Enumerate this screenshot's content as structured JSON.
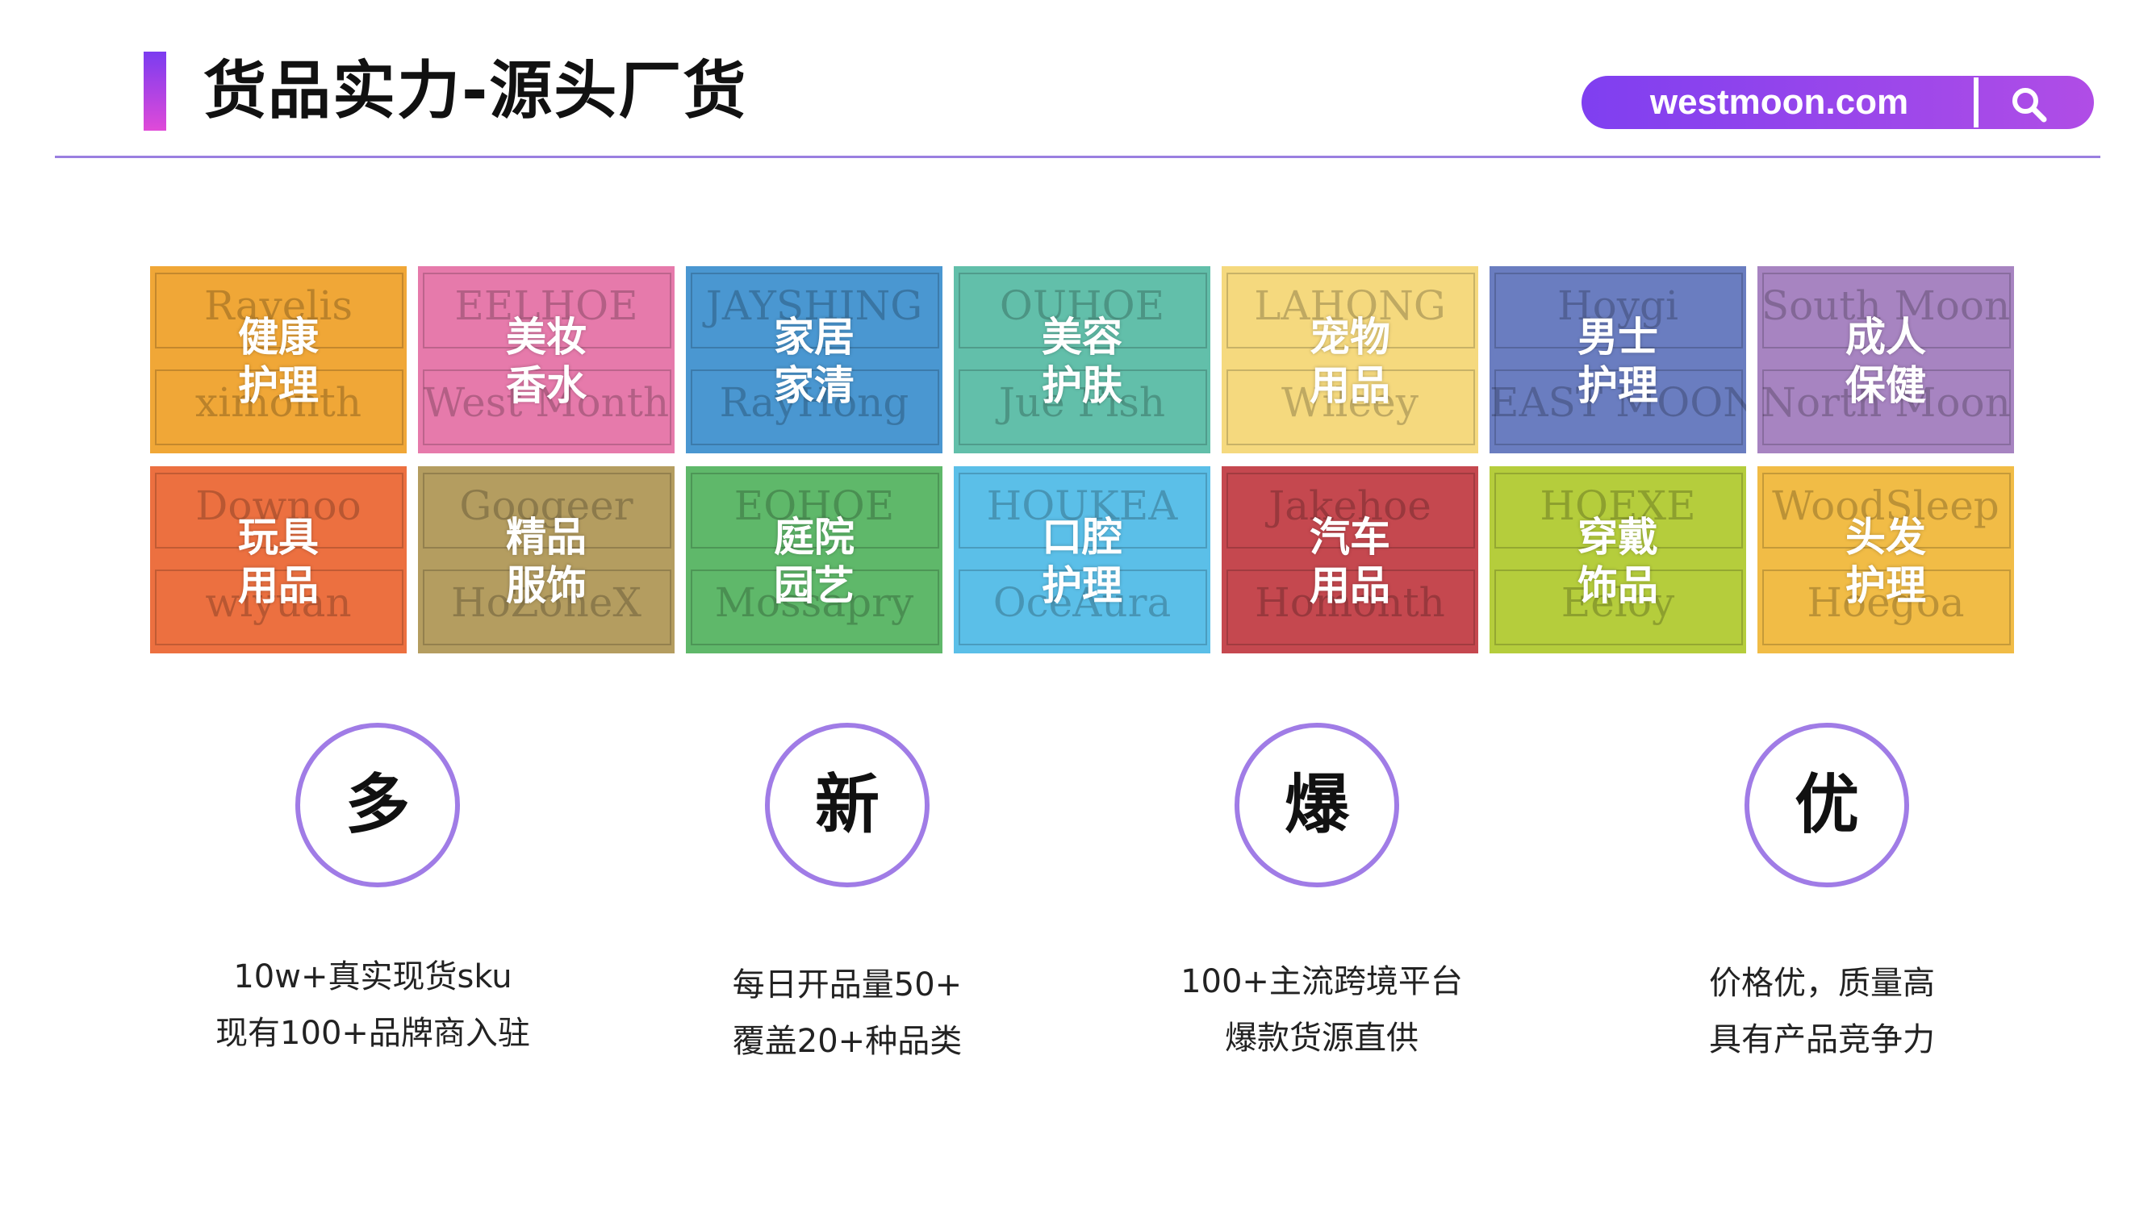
{
  "header": {
    "title": "货品实力-源头厂货",
    "search_url": "westmoon.com",
    "search_icon": "search-icon",
    "accent": "#8a3ff0"
  },
  "categories": [
    {
      "label_1": "健康",
      "label_2": "护理",
      "brand_1": "Ravelis",
      "brand_2": "ximonth",
      "color": "#f0a737"
    },
    {
      "label_1": "美妆",
      "label_2": "香水",
      "brand_1": "EELHOE",
      "brand_2": "West Month",
      "color": "#e67aab"
    },
    {
      "label_1": "家居",
      "label_2": "家清",
      "brand_1": "JAYSHING",
      "brand_2": "RayHong",
      "color": "#4a97d1"
    },
    {
      "label_1": "美容",
      "label_2": "护肤",
      "brand_1": "OUHOE",
      "brand_2": "Jue Fish",
      "color": "#62bfaa"
    },
    {
      "label_1": "宠物",
      "label_2": "用品",
      "brand_1": "LAHONG",
      "brand_2": "Wileey",
      "color": "#f5d97e"
    },
    {
      "label_1": "男士",
      "label_2": "护理",
      "brand_1": "Hoygi",
      "brand_2": "EAST MOON",
      "color": "#6a7dc0"
    },
    {
      "label_1": "成人",
      "label_2": "保健",
      "brand_1": "South Moon",
      "brand_2": "North Moon",
      "color": "#a784c1"
    },
    {
      "label_1": "玩具",
      "label_2": "用品",
      "brand_1": "Downoo",
      "brand_2": "wiyuan",
      "color": "#ec7040"
    },
    {
      "label_1": "精品",
      "label_2": "服饰",
      "brand_1": "Googeer",
      "brand_2": "HoZoneX",
      "color": "#b49d60"
    },
    {
      "label_1": "庭院",
      "label_2": "园艺",
      "brand_1": "EOHOE",
      "brand_2": "Mossapry",
      "color": "#5fb86a"
    },
    {
      "label_1": "口腔",
      "label_2": "护理",
      "brand_1": "HOUKEA",
      "brand_2": "OceAura",
      "color": "#5bbfe8"
    },
    {
      "label_1": "汽车",
      "label_2": "用品",
      "brand_1": "Jakehoe",
      "brand_2": "Homonth",
      "color": "#c5484f"
    },
    {
      "label_1": "穿戴",
      "label_2": "饰品",
      "brand_1": "HOEXE",
      "brand_2": "Eeloy",
      "color": "#b5cd3c"
    },
    {
      "label_1": "头发",
      "label_2": "护理",
      "brand_1": "WoodSleep",
      "brand_2": "Hoegoa",
      "color": "#f1bc46"
    }
  ],
  "features": [
    {
      "char": "多",
      "line_1": "10w+真实现货sku",
      "line_2": "现有100+品牌商入驻"
    },
    {
      "char": "新",
      "line_1": "每日开品量50+",
      "line_2": "覆盖20+种品类"
    },
    {
      "char": "爆",
      "line_1": "100+主流跨境平台",
      "line_2": "爆款货源直供"
    },
    {
      "char": "优",
      "line_1": "价格优，质量高",
      "line_2": "具有产品竞争力"
    }
  ]
}
